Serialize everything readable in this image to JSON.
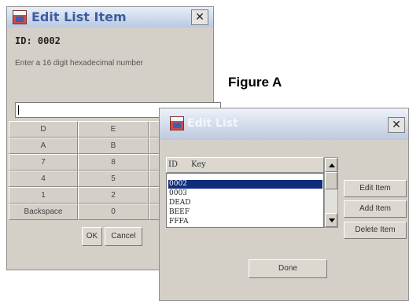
{
  "edit_item_dialog": {
    "title": "Edit List Item",
    "close_glyph": "✕",
    "id_label": "ID: 0002",
    "prompt": "Enter a 16 digit hexadecimal number",
    "input_value": "",
    "keypad": {
      "rows": [
        [
          "D",
          "E"
        ],
        [
          "A",
          "B"
        ],
        [
          "7",
          "8"
        ],
        [
          "4",
          "5"
        ],
        [
          "1",
          "2"
        ],
        [
          "Backspace",
          "0"
        ]
      ]
    },
    "ok_label": "OK",
    "cancel_label": "Cancel"
  },
  "figure_label": "Figure A",
  "edit_list_dialog": {
    "title": "Edit List",
    "close_glyph": "✕",
    "columns": [
      "ID",
      "Key"
    ],
    "rows": [
      {
        "id": "0002",
        "selected": true
      },
      {
        "id": "0003",
        "selected": false
      },
      {
        "id": "DEAD",
        "selected": false
      },
      {
        "id": "BEEF",
        "selected": false
      },
      {
        "id": "FFFA",
        "selected": false
      }
    ],
    "edit_label": "Edit Item",
    "add_label": "Add Item",
    "delete_label": "Delete Item",
    "done_label": "Done"
  },
  "colors": {
    "dialog_bg": "#d4d0c8",
    "title_text": "#3f5e9e",
    "selection": "#0f2d7a"
  }
}
